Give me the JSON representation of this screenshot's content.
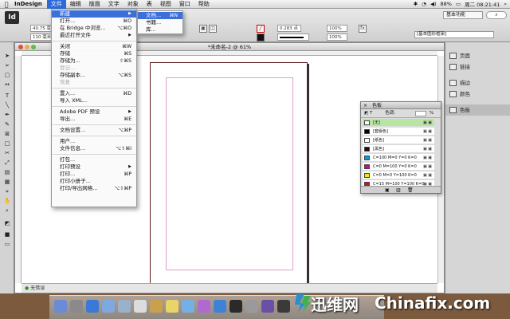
{
  "menubar": {
    "app_name": "InDesign",
    "items": [
      "文件",
      "编辑",
      "版面",
      "文字",
      "对象",
      "表",
      "视图",
      "窗口",
      "帮助"
    ],
    "battery": "88%",
    "clock": "周二 08:21:41"
  },
  "control": {
    "workspace": "基本功能",
    "x_value": "40.75 毫米",
    "y_value": "110 毫米",
    "stroke_value": "0.283 点",
    "percent_a": "100%",
    "percent_b": "100%",
    "para_style": "[基本图形框架]"
  },
  "document": {
    "title": "*未命名-2 @ 61%",
    "status": "无错误"
  },
  "file_menu": {
    "items": [
      {
        "label": "新建",
        "shortcut": "",
        "arrow": true,
        "highlighted": true
      },
      {
        "label": "打开...",
        "shortcut": "⌘O"
      },
      {
        "label": "在 Bridge 中浏览...",
        "shortcut": "⌥⌘O"
      },
      {
        "label": "最近打开文件",
        "shortcut": "",
        "arrow": true
      },
      {
        "label": "关闭",
        "shortcut": "⌘W"
      },
      {
        "label": "存储",
        "shortcut": "⌘S"
      },
      {
        "label": "存储为...",
        "shortcut": "⇧⌘S"
      },
      {
        "label": "登记...",
        "shortcut": "",
        "disabled": true
      },
      {
        "label": "存储副本...",
        "shortcut": "⌥⌘S"
      },
      {
        "label": "恢复",
        "shortcut": "",
        "disabled": true
      },
      {
        "label": "置入...",
        "shortcut": "⌘D"
      },
      {
        "label": "导入 XML...",
        "shortcut": ""
      },
      {
        "label": "Adobe PDF 预设",
        "shortcut": "",
        "arrow": true
      },
      {
        "label": "导出...",
        "shortcut": "⌘E"
      },
      {
        "label": "文档设置...",
        "shortcut": "⌥⌘P"
      },
      {
        "label": "用户...",
        "shortcut": ""
      },
      {
        "label": "文件信息...",
        "shortcut": "⌥⇧⌘I"
      },
      {
        "label": "打包...",
        "shortcut": ""
      },
      {
        "label": "打印预设",
        "shortcut": "",
        "arrow": true
      },
      {
        "label": "打印...",
        "shortcut": "⌘P"
      },
      {
        "label": "打印小册子...",
        "shortcut": ""
      },
      {
        "label": "打印/导出网格...",
        "shortcut": "⌥⇧⌘P"
      }
    ]
  },
  "new_submenu": {
    "items": [
      {
        "label": "文档...",
        "shortcut": "⌘N",
        "highlighted": true
      },
      {
        "label": "书籍...",
        "shortcut": ""
      },
      {
        "label": "库...",
        "shortcut": ""
      }
    ]
  },
  "right_panel": {
    "items": [
      "页面",
      "链接",
      "描边",
      "颜色",
      "色板"
    ]
  },
  "swatches": {
    "title": "色板",
    "tint_label": "色调:",
    "tint_value": "%",
    "rows": [
      {
        "name": "[无]",
        "color": "#ffffff",
        "selected": true
      },
      {
        "name": "[套版色]",
        "color": "#000000"
      },
      {
        "name": "[纸色]",
        "color": "#ffffff"
      },
      {
        "name": "[黑色]",
        "color": "#111111"
      },
      {
        "name": "C=100 M=0 Y=0 K=0",
        "color": "#00a0e0"
      },
      {
        "name": "C=0 M=100 Y=0 K=0",
        "color": "#e0007a"
      },
      {
        "name": "C=0 M=0 Y=100 K=0",
        "color": "#ffe600"
      },
      {
        "name": "C=15 M=100 Y=100 K=0",
        "color": "#c8102e"
      }
    ]
  },
  "watermark": {
    "cn": "迅维网",
    "en": "Chinafix.com"
  }
}
